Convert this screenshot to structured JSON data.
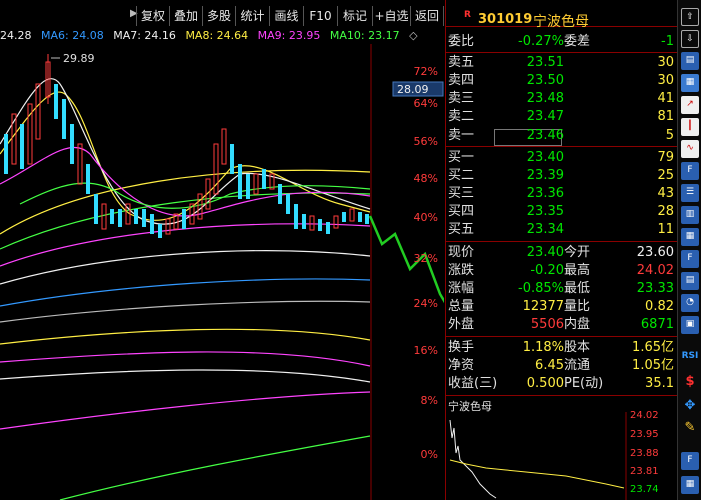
{
  "toolbar": {
    "buttons": [
      "复权",
      "叠加",
      "多股",
      "统计",
      "画线",
      "F10",
      "标记",
      "+自选",
      "返回"
    ]
  },
  "ma_legend": {
    "partial": "24.28",
    "ma6": "MA6: 24.08",
    "ma7": "MA7: 24.16",
    "ma8": "MA8: 24.64",
    "ma9": "MA9: 23.95",
    "ma10": "MA10: 23.17",
    "diamond": "◇"
  },
  "chart": {
    "high_marker": "29.89",
    "price_tag": "28.09",
    "pct_labels": [
      "72%",
      "64%",
      "56%",
      "48%",
      "40%",
      "32%",
      "24%",
      "16%",
      "8%",
      "0%"
    ]
  },
  "stock": {
    "badge": "R",
    "code": "301019",
    "name": "宁波色母"
  },
  "weibi": {
    "label": "委比",
    "value": "-0.27%",
    "label2": "委差",
    "value2": "-1"
  },
  "asks": [
    {
      "label": "卖五",
      "price": "23.51",
      "vol": "30"
    },
    {
      "label": "卖四",
      "price": "23.50",
      "vol": "30"
    },
    {
      "label": "卖三",
      "price": "23.48",
      "vol": "41"
    },
    {
      "label": "卖二",
      "price": "23.47",
      "vol": "81"
    },
    {
      "label": "卖一",
      "price": "23.46",
      "vol": "5"
    }
  ],
  "bids": [
    {
      "label": "买一",
      "price": "23.40",
      "vol": "79"
    },
    {
      "label": "买二",
      "price": "23.39",
      "vol": "25"
    },
    {
      "label": "买三",
      "price": "23.36",
      "vol": "43"
    },
    {
      "label": "买四",
      "price": "23.35",
      "vol": "28"
    },
    {
      "label": "买五",
      "price": "23.34",
      "vol": "11"
    }
  ],
  "stats": [
    {
      "label": "现价",
      "value": "23.40",
      "label2": "今开",
      "value2": "23.60"
    },
    {
      "label": "涨跌",
      "value": "-0.20",
      "label2": "最高",
      "value2": "24.02"
    },
    {
      "label": "涨幅",
      "value": "-0.85%",
      "label2": "最低",
      "value2": "23.33"
    },
    {
      "label": "总量",
      "value": "12377",
      "label2": "量比",
      "value2": "0.82"
    },
    {
      "label": "外盘",
      "value": "5506",
      "label2": "内盘",
      "value2": "6871"
    }
  ],
  "stats2": [
    {
      "label": "换手",
      "value": "1.18%",
      "label2": "股本",
      "value2": "1.65亿"
    },
    {
      "label": "净资",
      "value": "6.45",
      "label2": "流通",
      "value2": "1.05亿"
    },
    {
      "label": "收益(三)",
      "value": "0.500",
      "label2": "PE(动)",
      "value2": "35.1"
    }
  ],
  "mini_chart": {
    "title": "宁波色母",
    "y_labels": [
      "24.02",
      "23.95",
      "23.88",
      "23.81",
      "23.74"
    ]
  },
  "icons": [
    "scroll-up-icon",
    "scroll-down-icon",
    "kline-icon",
    "report-icon",
    "chart-icon",
    "candle-icon",
    "minute-icon",
    "f10-icon",
    "list-icon",
    "info-icon",
    "f12-icon",
    "table-icon",
    "pie-icon",
    "rsi-icon",
    "dollar-icon",
    "move-icon",
    "pencil-icon",
    "f5-icon",
    "calendar-icon"
  ]
}
